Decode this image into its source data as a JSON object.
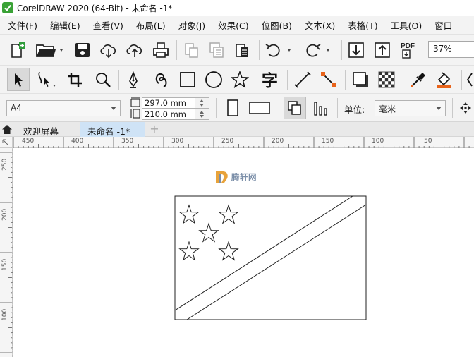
{
  "window": {
    "title": "CorelDRAW 2020 (64-Bit) - 未命名 -1*"
  },
  "menu": {
    "items": [
      "文件(F)",
      "编辑(E)",
      "查看(V)",
      "布局(L)",
      "对象(J)",
      "效果(C)",
      "位图(B)",
      "文本(X)",
      "表格(T)",
      "工具(O)",
      "窗口"
    ]
  },
  "standard_toolbar": {
    "zoom_level": "37%",
    "pdf_label": "PDF"
  },
  "toolbox_icons": [
    "pick-tool-icon",
    "freehand-pick-icon",
    "crop-tool-icon",
    "zoom-tool-icon",
    "pen-tool-icon",
    "artistic-media-icon",
    "rectangle-tool-icon",
    "ellipse-tool-icon",
    "polygon-star-icon",
    "text-tool-icon",
    "dimension-line-icon",
    "connector-tool-icon",
    "drop-shadow-icon",
    "transparency-icon",
    "eyedropper-icon",
    "interactive-fill-icon"
  ],
  "property_bar": {
    "page_size": "A4",
    "width_value": "297.0 mm",
    "height_value": "210.0 mm",
    "unit_label": "单位:",
    "unit_value": "毫米"
  },
  "tabs": {
    "welcome": "欢迎屏幕",
    "document": "未命名 -1*",
    "add": "+"
  },
  "ruler": {
    "horizontal_labels": [
      "450",
      "400",
      "350",
      "300",
      "250",
      "200",
      "150",
      "100",
      "50"
    ],
    "vertical_labels": [
      "250",
      "200",
      "150",
      "100"
    ]
  },
  "watermark": {
    "text": "腾轩网"
  }
}
